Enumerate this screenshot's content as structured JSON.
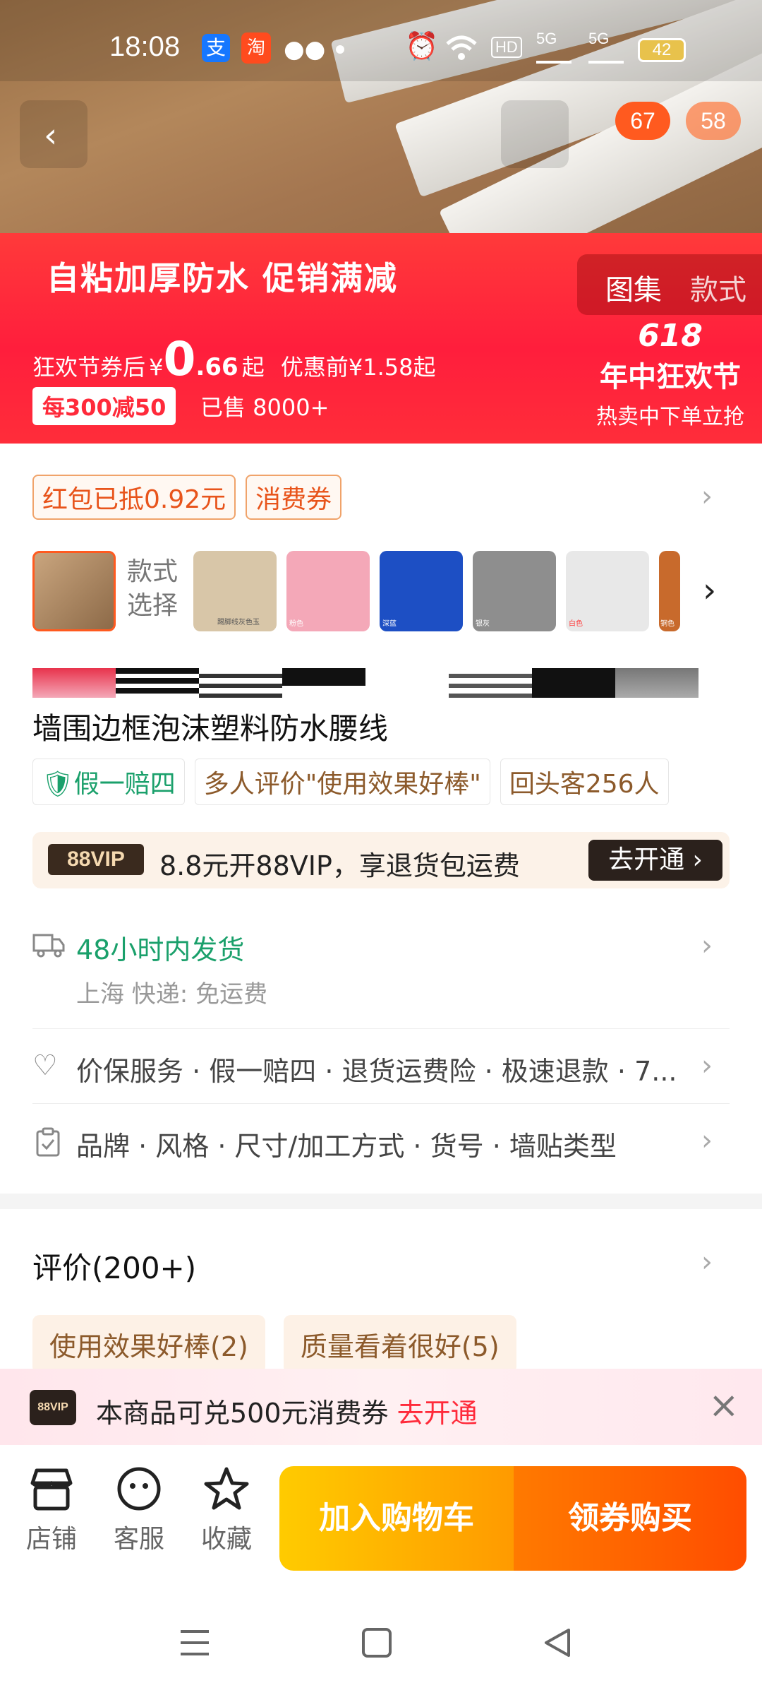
{
  "status": {
    "time": "18:08",
    "battery": "42",
    "net1": "5G",
    "net2": "5G",
    "hd": "HD"
  },
  "hero": {
    "badge_left": "67",
    "badge_right": "58"
  },
  "promo": {
    "title": "自粘加厚防水  促销满减",
    "tab_gallery": "图集",
    "tab_style": "款式",
    "price_prefix": "狂欢节券后",
    "currency": "¥",
    "price_main": "0",
    "price_decimal": ".66",
    "price_suffix": "起",
    "original_price": "优惠前¥1.58起",
    "coupon": "每300减50",
    "sold": "已售 8000+",
    "festival_num": "618",
    "festival_title": "年中狂欢节",
    "festival_sub": "热卖中下单立抢"
  },
  "coupons": {
    "red_packet": "红包已抵0.92元",
    "voucher": "消费券"
  },
  "style_select": {
    "label_line1": "款式",
    "label_line2": "选择",
    "thumb_labels": [
      "踢脚线灰色玉",
      "粉色",
      "深蓝",
      "银灰",
      "白色",
      "铜色"
    ],
    "colors": [
      "#d8c6a8",
      "#f4a8b8",
      "#1d4fc4",
      "#8e8e8e",
      "#e8e8e8",
      "#c86a2c"
    ]
  },
  "product": {
    "title": "墙围边框泡沫塑料防水腰线",
    "tags": [
      "假一赔四",
      "多人评价\"使用效果好棒\"",
      "回头客256人"
    ]
  },
  "vip": {
    "logo": "88VIP",
    "text": "8.8元开88VIP，享退货包运费",
    "button": "去开通"
  },
  "shipping": {
    "title": "48小时内发货",
    "sub": "上海  快递: 免运费"
  },
  "services": {
    "items": [
      "价保服务",
      "假一赔四",
      "退货运费险",
      "极速退款",
      "7..."
    ]
  },
  "params": {
    "items": [
      "品牌",
      "风格",
      "尺寸/加工方式",
      "货号",
      "墙贴类型"
    ]
  },
  "reviews": {
    "title": "评价(200+)",
    "tags": [
      "使用效果好棒(2)",
      "质量看着很好(5)"
    ]
  },
  "vip_popup": {
    "logo": "88VIP",
    "text": "本商品可兑500元消费券",
    "link": "去开通"
  },
  "bottom_bar": {
    "store": "店铺",
    "service": "客服",
    "favorite": "收藏",
    "add_cart": "加入购物车",
    "buy": "领券购买"
  },
  "colors": {
    "accent_red": "#ff2a3a",
    "green": "#1aa06b",
    "orange": "#ff7a00"
  }
}
